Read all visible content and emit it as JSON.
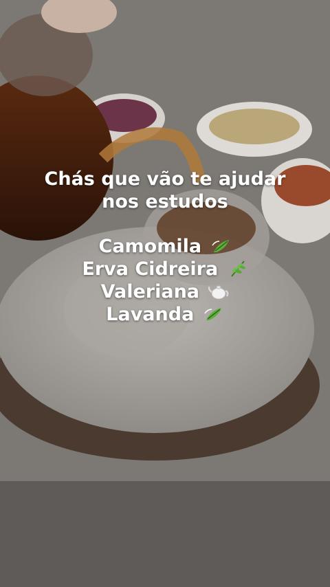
{
  "caption": {
    "headline_line1": "Chás que vão te ajudar",
    "headline_line2": "nos estudos",
    "items": [
      {
        "label": "Camomila",
        "icon": "leaf-fluttering-icon"
      },
      {
        "label": "Erva Cidreira",
        "icon": "herb-icon"
      },
      {
        "label": "Valeriana",
        "icon": "teapot-icon"
      },
      {
        "label": "Lavanda",
        "icon": "leaf-fluttering-icon"
      }
    ]
  }
}
